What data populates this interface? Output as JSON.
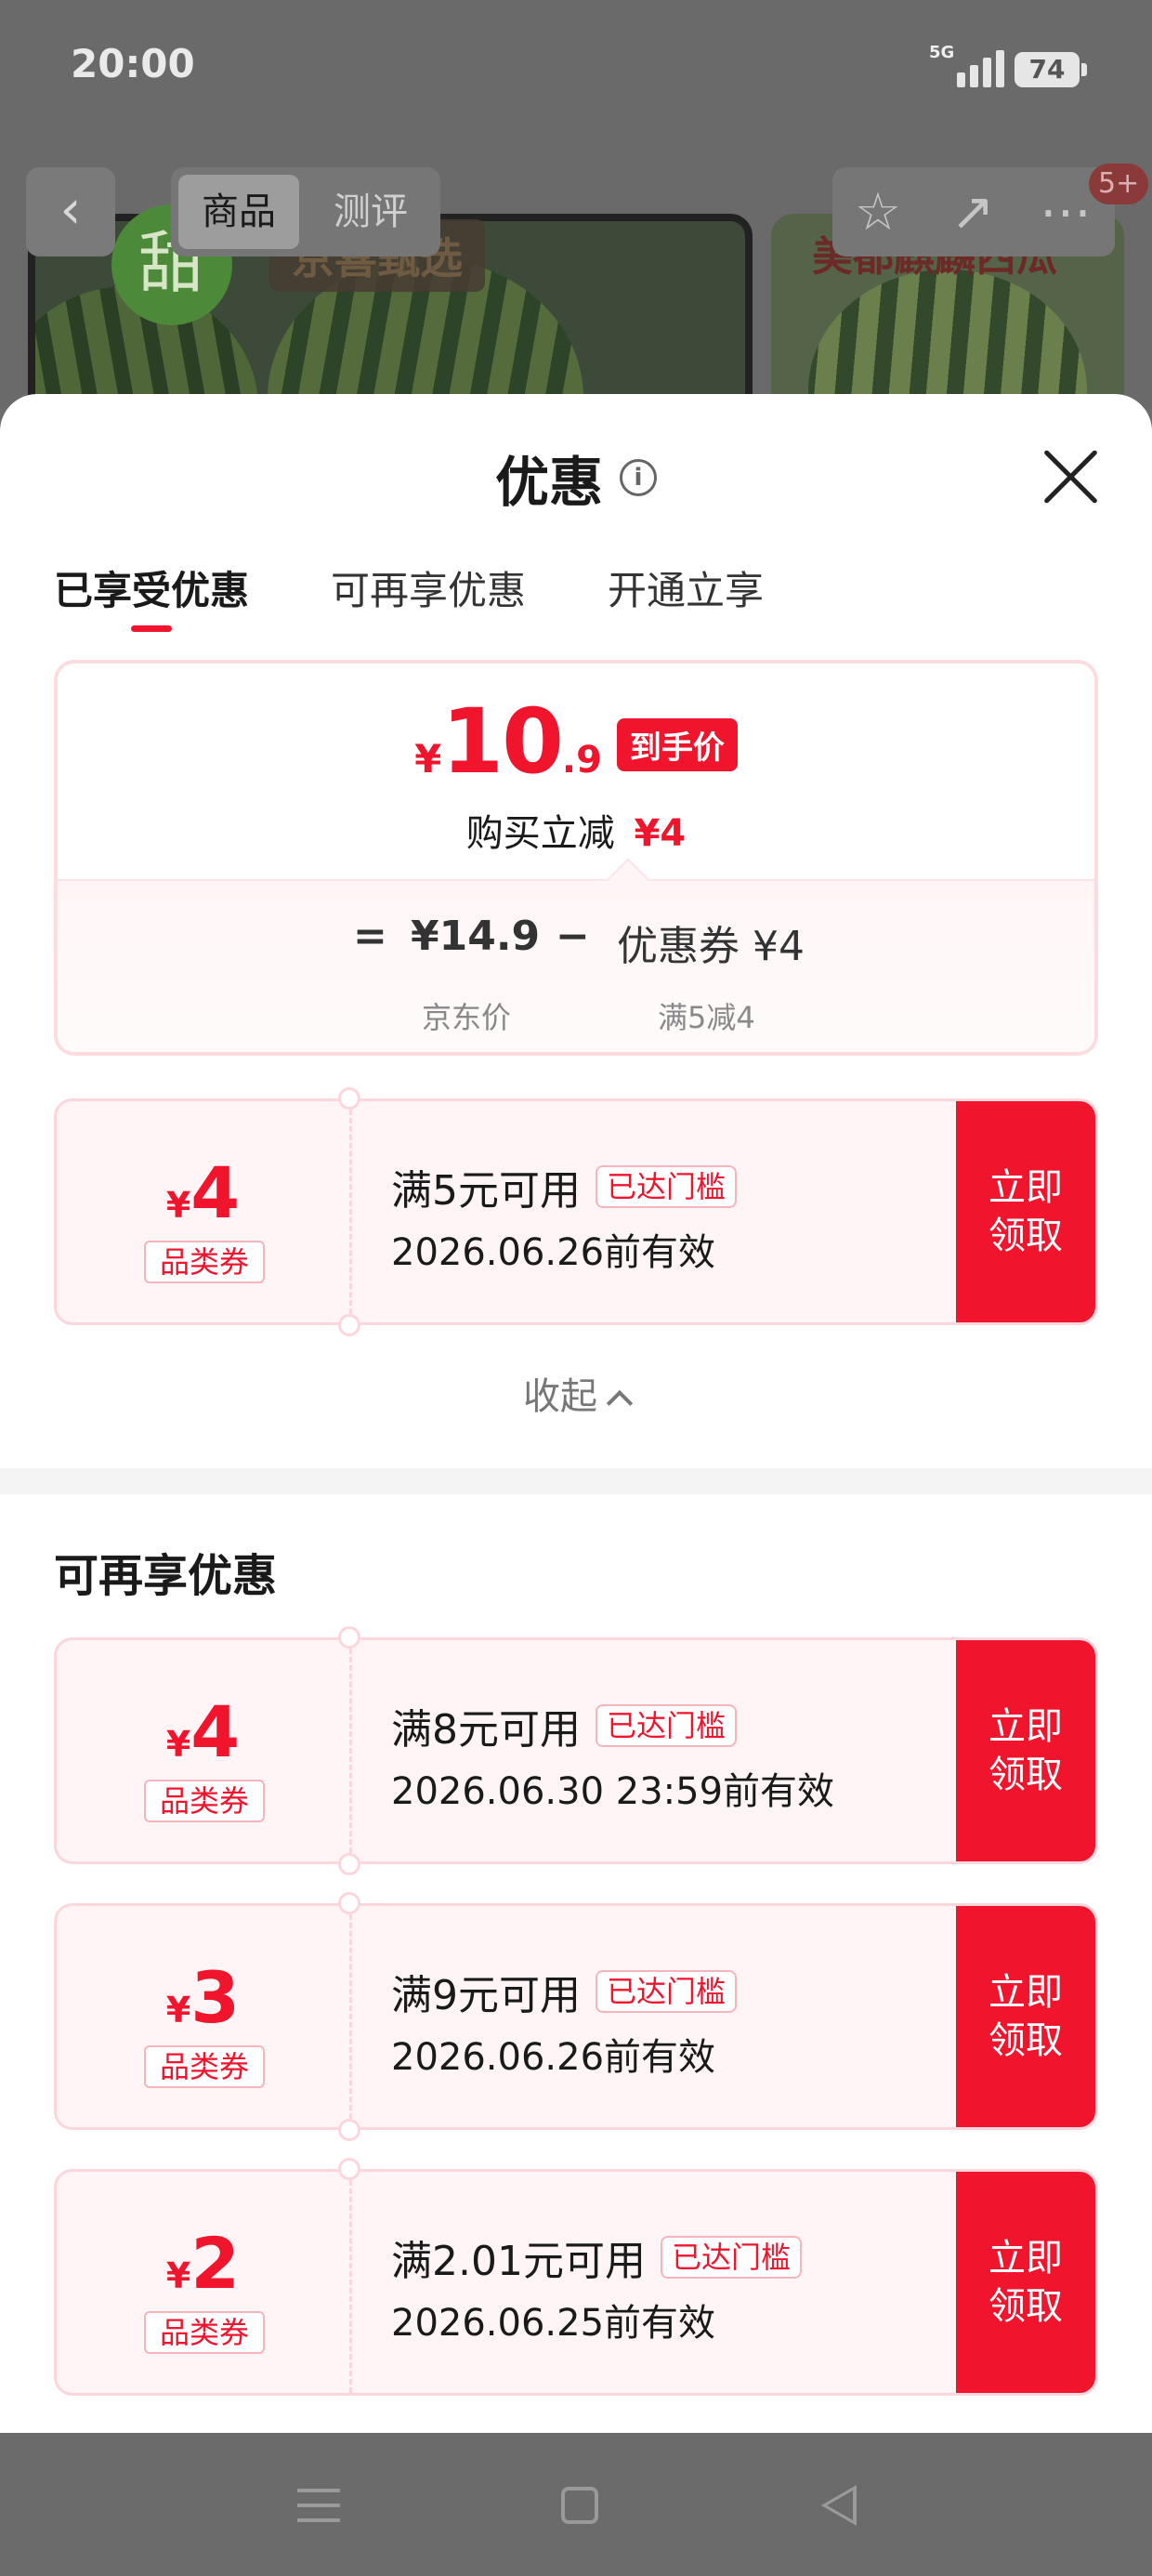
{
  "status_bar": {
    "time": "20:00",
    "network": "5G",
    "battery": "74"
  },
  "backdrop": {
    "tabs": [
      "商品",
      "测评"
    ],
    "sweet_badge": "甜",
    "store_label_left": "京喜甄选",
    "store_label_right": "美都麒麟西瓜",
    "message_count": "5+"
  },
  "sheet": {
    "title": "优惠",
    "tabs": [
      "已享受优惠",
      "可再享优惠",
      "开通立享"
    ],
    "summary": {
      "currency": "¥",
      "price_int": "10",
      "price_dec": ".9",
      "price_badge": "到手价",
      "reduce_label": "购买立减",
      "reduce_amount": "¥4",
      "eq": "=",
      "base_price": "¥14.9",
      "minus": "−",
      "coupon_label": "优惠券 ¥4",
      "base_price_sub": "京东价",
      "coupon_sub": "满5减4"
    },
    "applied_coupon": {
      "amount": "4",
      "currency": "¥",
      "type": "品类券",
      "condition": "满5元可用",
      "tag": "已达门槛",
      "validity": "2026.06.26前有效",
      "button_line1": "立即",
      "button_line2": "领取"
    },
    "collapse_label": "收起",
    "more_section_title": "可再享优惠",
    "more_coupons": [
      {
        "amount": "4",
        "currency": "¥",
        "type": "品类券",
        "condition": "满8元可用",
        "tag": "已达门槛",
        "validity": "2026.06.30 23:59前有效",
        "button_line1": "立即",
        "button_line2": "领取"
      },
      {
        "amount": "3",
        "currency": "¥",
        "type": "品类券",
        "condition": "满9元可用",
        "tag": "已达门槛",
        "validity": "2026.06.26前有效",
        "button_line1": "立即",
        "button_line2": "领取"
      },
      {
        "amount": "2",
        "currency": "¥",
        "type": "品类券",
        "condition": "满2.01元可用",
        "tag": "已达门槛",
        "validity": "2026.06.25前有效",
        "button_line1": "立即",
        "button_line2": "领取"
      }
    ]
  },
  "colors": {
    "accent": "#f0142d",
    "coupon_bg": "#fff5f6"
  },
  "icons": [
    "back-arrow-icon",
    "star-icon",
    "share-icon",
    "more-icon",
    "info-icon",
    "close-icon",
    "chevron-up-icon",
    "nav-menu-icon",
    "nav-home-icon",
    "nav-back-icon"
  ]
}
